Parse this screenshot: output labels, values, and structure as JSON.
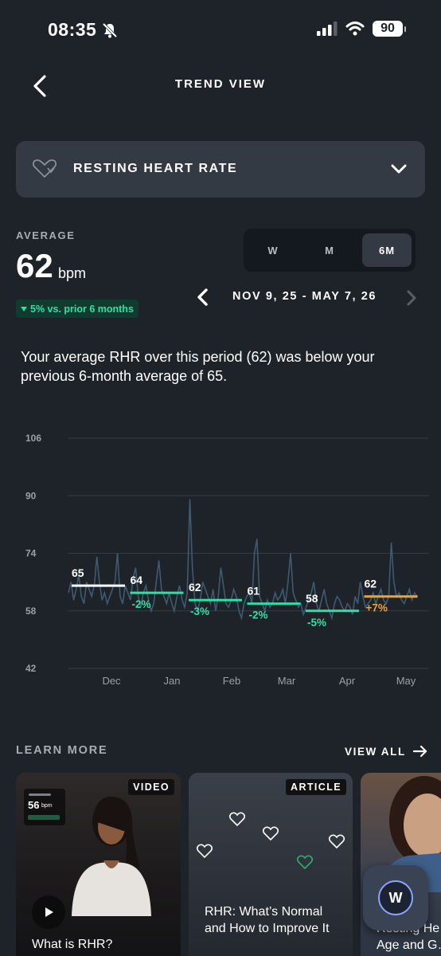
{
  "status_bar": {
    "time": "08:35",
    "battery": "90"
  },
  "header": {
    "title": "TREND VIEW"
  },
  "metric_selector": {
    "label": "RESTING HEART RATE"
  },
  "average": {
    "label": "AVERAGE",
    "value": "62",
    "unit": "bpm",
    "delta": "5% vs. prior 6 months"
  },
  "period_toggle": {
    "options": [
      "W",
      "M",
      "6M"
    ],
    "selected": "6M"
  },
  "date_range": "NOV 9, 25 - MAY 7, 26",
  "summary": "Your average RHR over this period (62) was below your previous 6-month average of 65.",
  "chart_data": {
    "type": "line",
    "y_ticks": [
      "106",
      "90",
      "74",
      "58",
      "42"
    ],
    "ylim": [
      42,
      106
    ],
    "x_labels": [
      "Dec",
      "Jan",
      "Feb",
      "Mar",
      "Apr",
      "May"
    ],
    "grid": true,
    "monthly_averages": [
      {
        "value": 65,
        "label": "65",
        "change": ""
      },
      {
        "value": 63,
        "label": "64",
        "change": "-2%"
      },
      {
        "value": 61,
        "label": "62",
        "change": "-3%"
      },
      {
        "value": 60,
        "label": "61",
        "change": "-2%"
      },
      {
        "value": 58,
        "label": "58",
        "change": "-5%"
      },
      {
        "value": 62,
        "label": "62",
        "change": "+7%"
      }
    ],
    "colors": {
      "baseline": "#ffffff",
      "decrease": "#2fe0a4",
      "increase": "#f0a23a",
      "line": "#3f5a70"
    },
    "daily_series": [
      63,
      66,
      61,
      64,
      68,
      62,
      60,
      66,
      64,
      62,
      65,
      73,
      66,
      61,
      63,
      60,
      62,
      64,
      66,
      74,
      62,
      60,
      65,
      63,
      61,
      67,
      70,
      62,
      59,
      63,
      65,
      61,
      58,
      60,
      66,
      72,
      64,
      62,
      60,
      63,
      60,
      58,
      62,
      65,
      61,
      59,
      63,
      89,
      70,
      60,
      58,
      61,
      66,
      64,
      62,
      60,
      64,
      58,
      62,
      70,
      65,
      60,
      59,
      61,
      64,
      62,
      58,
      56,
      60,
      62,
      63,
      60,
      74,
      78,
      62,
      60,
      58,
      61,
      59,
      60,
      63,
      61,
      62,
      64,
      60,
      66,
      74,
      63,
      61,
      59,
      60,
      57,
      59,
      61,
      63,
      66,
      60,
      58,
      61,
      64,
      60,
      58,
      56,
      60,
      62,
      61,
      59,
      58,
      60,
      59,
      57,
      62,
      60,
      66,
      62,
      59,
      60,
      61,
      63,
      60,
      62,
      64,
      61,
      60,
      62,
      77,
      66,
      62,
      63,
      61,
      60,
      62,
      64,
      61,
      63,
      62
    ]
  },
  "learn_more": {
    "label": "LEARN MORE",
    "view_all": "VIEW ALL",
    "cards": [
      {
        "tag": "VIDEO",
        "title": "What is RHR?",
        "overlay_value": "56",
        "overlay_unit": "bpm"
      },
      {
        "tag": "ARTICLE",
        "title": "RHR: What’s Normal and How to Improve It"
      },
      {
        "tag": "",
        "title": "a G… Resting He… Age and G…"
      }
    ]
  },
  "fab": {
    "letter": "W"
  }
}
